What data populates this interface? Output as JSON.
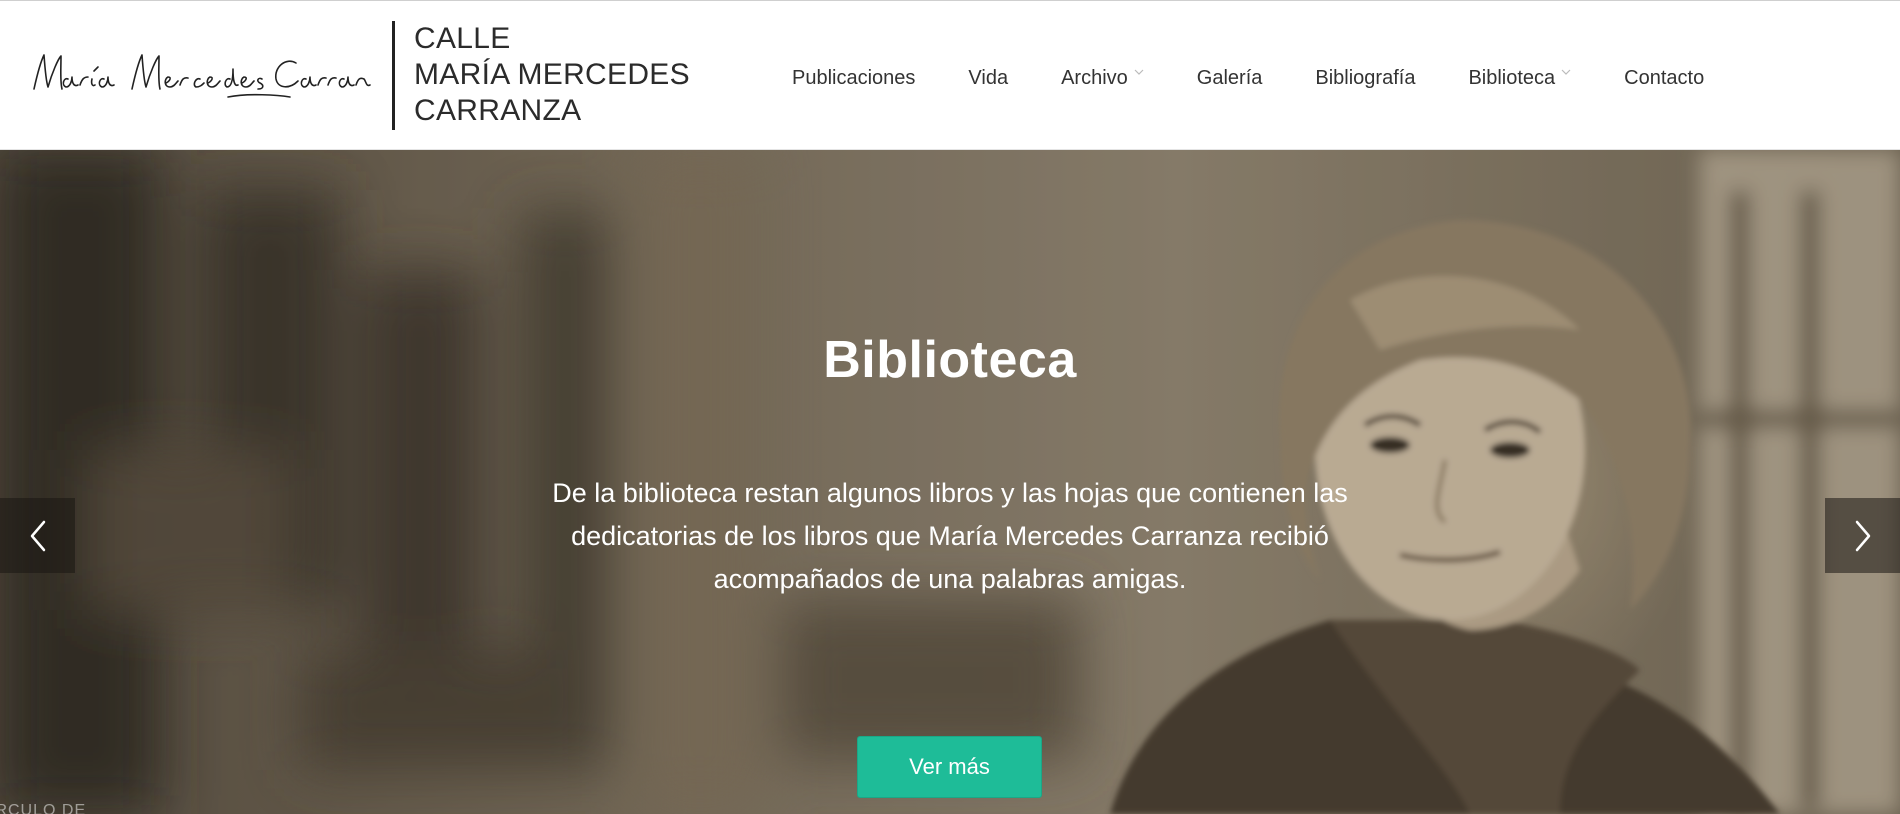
{
  "header": {
    "logo_signature": "María Mercedes Carranza",
    "site_title_lines": [
      "CALLE",
      "MARÍA MERCEDES",
      "CARRANZA"
    ],
    "nav": [
      {
        "label": "Publicaciones",
        "has_dropdown": false
      },
      {
        "label": "Vida",
        "has_dropdown": false
      },
      {
        "label": "Archivo",
        "has_dropdown": true
      },
      {
        "label": "Galería",
        "has_dropdown": false
      },
      {
        "label": "Bibliografía",
        "has_dropdown": false
      },
      {
        "label": "Biblioteca",
        "has_dropdown": true
      },
      {
        "label": "Contacto",
        "has_dropdown": false
      }
    ]
  },
  "slider": {
    "title": "Biblioteca",
    "description": "De la biblioteca restan algunos libros y las hojas que contienen las dedicatorias de los libros que María Mercedes Carranza recibió acompañados de una palabras amigas.",
    "cta_label": "Ver más",
    "corner_text": "ÍRCULO DE",
    "prev_icon": "chevron-left-icon",
    "next_icon": "chevron-right-icon"
  },
  "colors": {
    "accent_button": "#1ebc98",
    "progress_line": "#2a8fd1",
    "title_text": "#2b2b2b"
  }
}
